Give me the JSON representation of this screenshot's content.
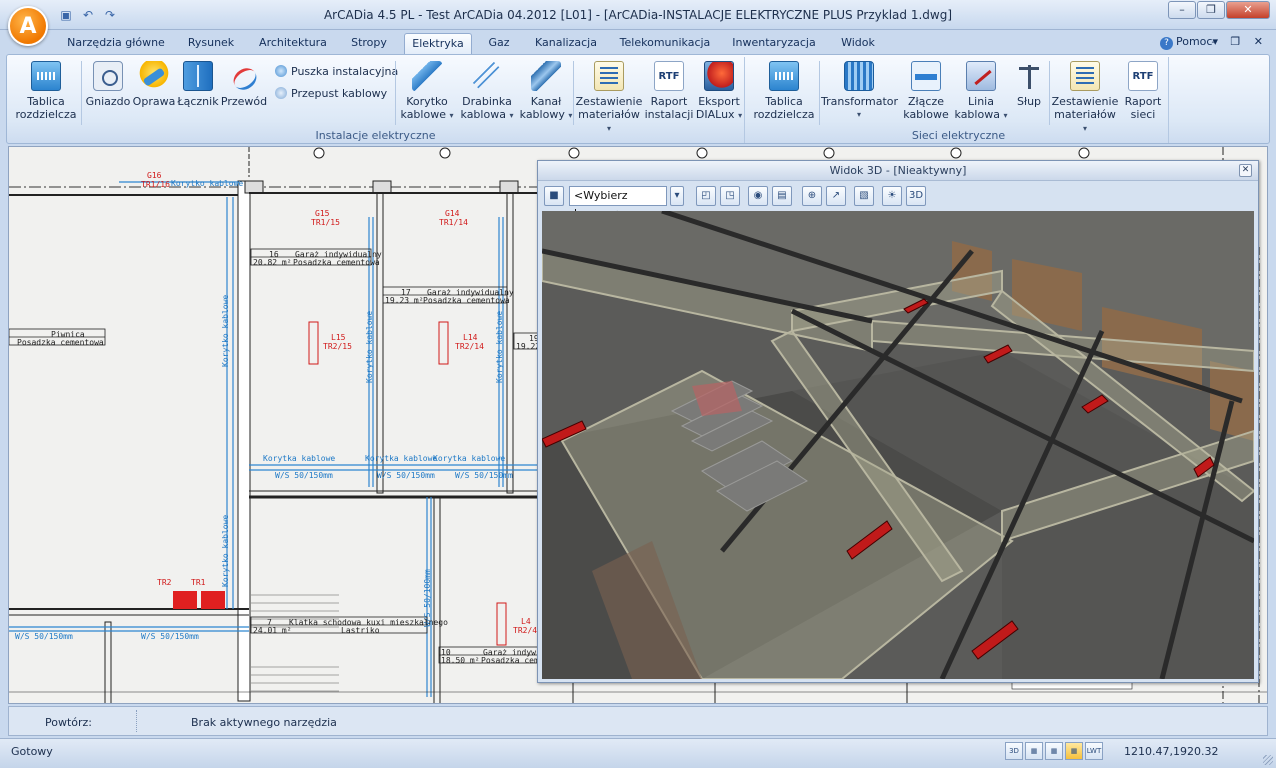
{
  "window": {
    "title": "ArCADia 4.5 PL - Test ArCADia 04.2012 [L01] - [ArCADia-INSTALACJE ELEKTRYCZNE PLUS Przyklad 1.dwg]",
    "minimize": "–",
    "restore": "❐",
    "close": "✕"
  },
  "tabs": [
    {
      "label": "Narzędzia główne"
    },
    {
      "label": "Rysunek"
    },
    {
      "label": "Architektura"
    },
    {
      "label": "Stropy"
    },
    {
      "label": "Elektryka",
      "active": true
    },
    {
      "label": "Gaz"
    },
    {
      "label": "Kanalizacja"
    },
    {
      "label": "Telekomunikacja"
    },
    {
      "label": "Inwentaryzacja"
    },
    {
      "label": "Widok"
    }
  ],
  "help": {
    "label": "Pomoc",
    "caret": "▾"
  },
  "mdi_controls": "– ❐ ✕",
  "ribbon": {
    "group1": {
      "label": "Instalacje elektryczne",
      "tablica": {
        "line1": "Tablica",
        "line2": "rozdzielcza"
      },
      "gniazdo": "Gniazdo",
      "oprawa": "Oprawa",
      "lacznik": "Łącznik",
      "przewod": "Przewód",
      "puszka": "Puszka instalacyjna",
      "przepust": "Przepust kablowy",
      "korytko": {
        "line1": "Korytko",
        "line2": "kablowe"
      },
      "drabinka": {
        "line1": "Drabinka",
        "line2": "kablowa"
      },
      "kanal": {
        "line1": "Kanał",
        "line2": "kablowy"
      },
      "zestawienie": {
        "line1": "Zestawienie",
        "line2": "materiałów"
      },
      "raport": {
        "line1": "Raport",
        "line2": "instalacji"
      },
      "eksport": {
        "line1": "Eksport",
        "line2": "DIALux"
      }
    },
    "group2": {
      "label": "Sieci elektryczne",
      "tablica": {
        "line1": "Tablica",
        "line2": "rozdzielcza"
      },
      "transformator": "Transformator",
      "zlacze": {
        "line1": "Złącze",
        "line2": "kablowe"
      },
      "linia": {
        "line1": "Linia",
        "line2": "kablowa"
      },
      "slup": "Słup",
      "zestawienie": {
        "line1": "Zestawienie",
        "line2": "materiałów"
      },
      "raport": {
        "line1": "Raport",
        "line2": "sieci"
      }
    },
    "rtf_text": "RTF",
    "caret": "▾"
  },
  "drawing": {
    "labels": {
      "g16": "G16",
      "g16_tr": "TR1/16",
      "g15": "G15",
      "g15_tr": "TR1/15",
      "g14": "G14",
      "g14_tr": "TR1/14",
      "l15": "L15",
      "l15_tr": "TR2/15",
      "l14": "L14",
      "l14_tr": "TR2/14",
      "l4": "L4",
      "l4_tr": "TR2/4",
      "tr2": "TR2",
      "tr1": "TR1",
      "korytko": "Korytko kablowe",
      "korytka": "Korytka kablowe",
      "ws150": "W/S 50/150mm",
      "ws100": "W/S 50/100mm",
      "garaz": "Garaż indywidualny",
      "posadzka": "Posadzka cementowa",
      "piwnica": "Piwnica",
      "klatka": "Klatka schodowa kuxi mieszkalnego",
      "lastriko": "Lastriko",
      "r16": "16",
      "r16a": "20.82 m²",
      "r17": "17",
      "r17a": "19.23 m²",
      "r19": "19",
      "r19a": "19.22",
      "r7": "7",
      "r7a": "24.01 m²",
      "r10": "10",
      "r10a": "18.50 m²"
    }
  },
  "view3d": {
    "title": "Widok 3D - [Nieaktywny]",
    "close": "✕",
    "camera_select": "<Wybierz kamerę>",
    "toolbar_icons": [
      "camera-icon",
      "dropdown-icon",
      "view-front-icon",
      "view-back-icon",
      "render-icon",
      "walls-icon",
      "orbit-icon",
      "pan-icon",
      "section-icon",
      "light-icon",
      "3d-icon"
    ]
  },
  "command": {
    "label": "Powtórz:",
    "value": "Brak aktywnego narzędzia"
  },
  "status": {
    "text": "Gotowy",
    "coords": "1210.47,1920.32",
    "icons": [
      "3D",
      "▦",
      "▦",
      "▦",
      "LWT"
    ]
  }
}
